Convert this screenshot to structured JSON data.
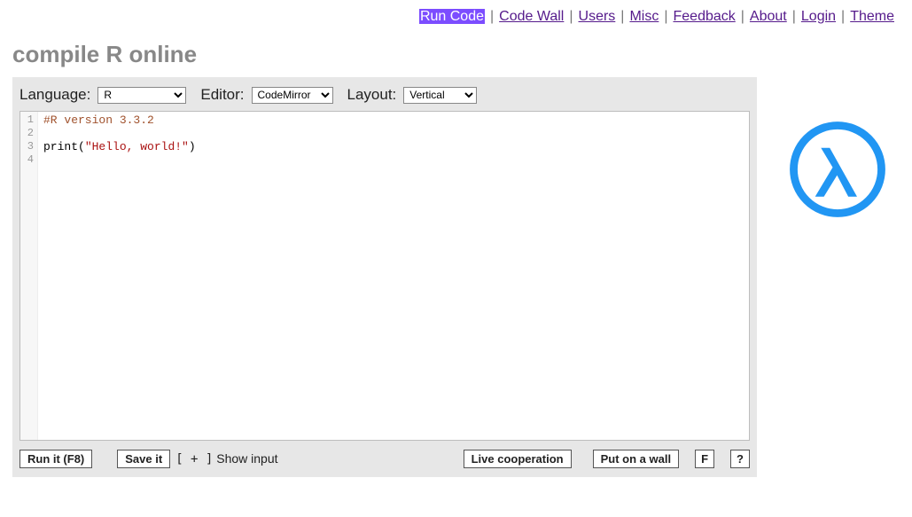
{
  "nav": {
    "items": [
      {
        "label": "Run Code",
        "active": true
      },
      {
        "label": "Code Wall",
        "active": false
      },
      {
        "label": "Users",
        "active": false
      },
      {
        "label": "Misc",
        "active": false
      },
      {
        "label": "Feedback",
        "active": false
      },
      {
        "label": "About",
        "active": false
      },
      {
        "label": "Login",
        "active": false
      },
      {
        "label": "Theme",
        "active": false
      }
    ]
  },
  "title": "compile R online",
  "controls": {
    "language_label": "Language:",
    "language_value": "R",
    "editor_label": "Editor:",
    "editor_value": "CodeMirror",
    "layout_label": "Layout:",
    "layout_value": "Vertical"
  },
  "code": {
    "line_count": 4,
    "tokens": [
      [
        {
          "cls": "tok-comment",
          "text": "#R version 3.3.2"
        }
      ],
      [],
      [
        {
          "cls": "tok-builtin",
          "text": "print"
        },
        {
          "cls": "tok-paren",
          "text": "("
        },
        {
          "cls": "tok-string",
          "text": "\"Hello, world!\""
        },
        {
          "cls": "tok-paren",
          "text": ")"
        }
      ],
      []
    ]
  },
  "bottom": {
    "run": "Run it (F8)",
    "save": "Save it",
    "show_input_plus": "[ + ]",
    "show_input_label": "Show input",
    "live": "Live cooperation",
    "wall": "Put on a wall",
    "fullscreen": "F",
    "help": "?"
  }
}
